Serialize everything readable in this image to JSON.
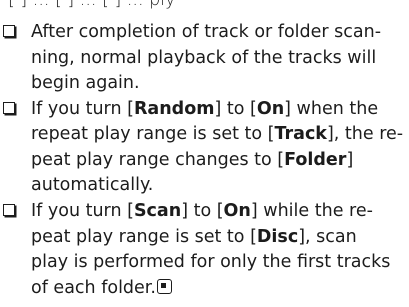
{
  "top_fragment": "[ ] ... [ ] ... [ ] ... ply",
  "notes": [
    {
      "lines": [
        "After completion of track or folder scan-",
        "ning, normal playback of the tracks will",
        "begin again."
      ]
    },
    {
      "l1_a": "If you turn [",
      "l1_b": "Random",
      "l1_c": "] to [",
      "l1_d": "On",
      "l1_e": "] when the",
      "l2_a": "repeat play range is set to [",
      "l2_b": "Track",
      "l2_c": "], the re-",
      "l3_a": "peat play range changes to [",
      "l3_b": "Folder",
      "l3_c": "]",
      "l4": "automatically."
    },
    {
      "l1_a": "If you turn [",
      "l1_b": "Scan",
      "l1_c": "] to [",
      "l1_d": "On",
      "l1_e": "] while the re-",
      "l2_a": "peat play range is set to [",
      "l2_b": "Disc",
      "l2_c": "], scan",
      "l3": "play is performed for only the first tracks",
      "l4": "of each folder."
    }
  ]
}
